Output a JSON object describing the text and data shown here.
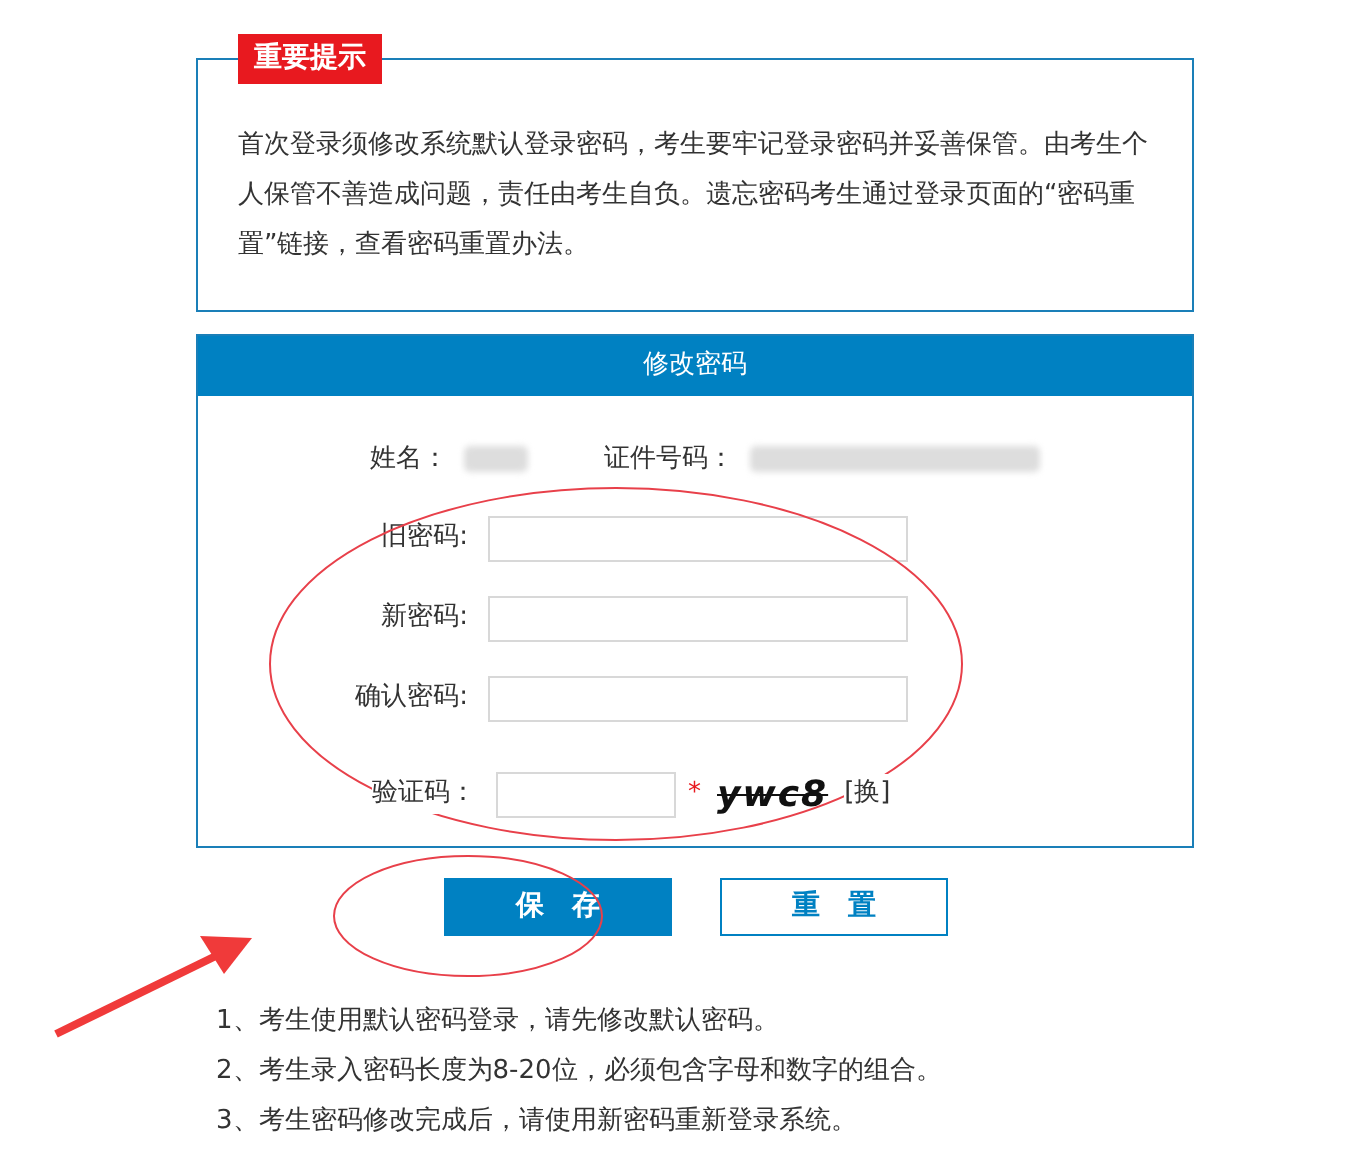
{
  "notice": {
    "badge": "重要提示",
    "text": "首次登录须修改系统默认登录密码，考生要牢记登录密码并妥善保管。由考生个人保管不善造成问题，责任由考生自负。遗忘密码考生通过登录页面的“密码重置”链接，查看密码重置办法。"
  },
  "form": {
    "title": "修改密码",
    "name_label": "姓名：",
    "id_label": "证件号码：",
    "fields": [
      {
        "label": "旧密码:",
        "kind": "text"
      },
      {
        "label": "新密码:",
        "kind": "text"
      },
      {
        "label": "确认密码:",
        "kind": "text"
      },
      {
        "label": "验证码：",
        "kind": "captcha",
        "required_mark": "*",
        "captcha": "ywc8",
        "refresh": "[换]"
      }
    ]
  },
  "buttons": [
    {
      "label": "保　存",
      "kind": "primary"
    },
    {
      "label": "重　置",
      "kind": "outline"
    }
  ],
  "notes": [
    "1、考生使用默认密码登录，请先修改默认密码。",
    "2、考生录入密码长度为8-20位，必须包含字母和数字的组合。",
    "3、考生密码修改完成后，请使用新密码重新登录系统。"
  ]
}
